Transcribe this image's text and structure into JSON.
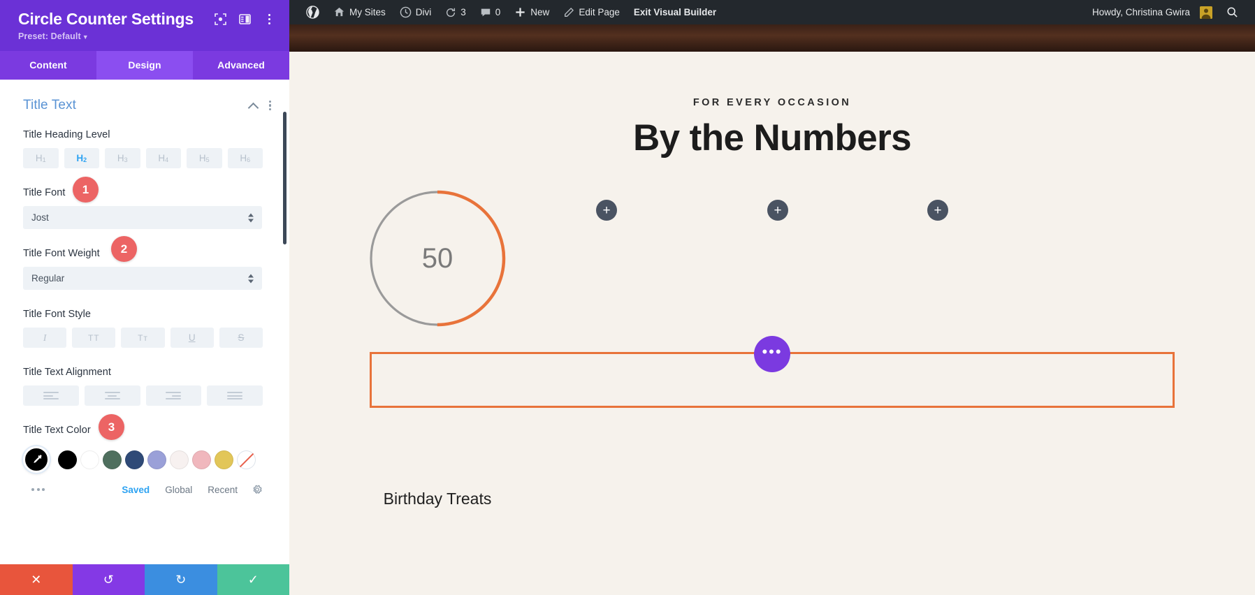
{
  "panel": {
    "title": "Circle Counter Settings",
    "preset_label": "Preset: Default",
    "header_icons": [
      {
        "name": "focus-target-icon"
      },
      {
        "name": "panel-layout-icon"
      },
      {
        "name": "more-options-icon"
      }
    ],
    "tabs": [
      {
        "label": "Content",
        "active": false
      },
      {
        "label": "Design",
        "active": true
      },
      {
        "label": "Advanced",
        "active": false
      }
    ],
    "section": {
      "title": "Title Text",
      "collapse_icon": "chevron-up-icon",
      "menu_icon": "section-options-icon"
    },
    "fields": {
      "heading_level": {
        "label": "Title Heading Level",
        "options": [
          "H1",
          "H2",
          "H3",
          "H4",
          "H5",
          "H6"
        ],
        "option_numbers": [
          "1",
          "2",
          "3",
          "4",
          "5",
          "6"
        ],
        "selected": "H2"
      },
      "title_font": {
        "label": "Title Font",
        "value": "Jost",
        "badge": "1"
      },
      "title_font_weight": {
        "label": "Title Font Weight",
        "value": "Regular",
        "badge": "2"
      },
      "title_font_style": {
        "label": "Title Font Style",
        "options": [
          {
            "glyph": "I",
            "name": "italic"
          },
          {
            "glyph": "TT",
            "name": "uppercase"
          },
          {
            "glyph": "Tᴛ",
            "name": "small-caps"
          },
          {
            "glyph": "U",
            "name": "underline"
          },
          {
            "glyph": "S",
            "name": "strikethrough"
          }
        ]
      },
      "title_text_alignment": {
        "label": "Title Text Alignment",
        "options": [
          "left",
          "center",
          "right",
          "justify"
        ]
      },
      "title_text_color": {
        "label": "Title Text Color",
        "badge": "3",
        "active_tool": "eyedropper",
        "swatches": [
          {
            "hex": "#000000",
            "name": "black"
          },
          {
            "hex": "#ffffff",
            "name": "white"
          },
          {
            "hex": "#4f6f5e",
            "name": "sage-green"
          },
          {
            "hex": "#2f4a77",
            "name": "navy-blue"
          },
          {
            "hex": "#9aa0d8",
            "name": "periwinkle"
          },
          {
            "hex": "#f7f1f0",
            "name": "off-white"
          },
          {
            "hex": "#f0b7bd",
            "name": "blush-pink"
          },
          {
            "hex": "#e2c659",
            "name": "gold"
          },
          {
            "hex": "none",
            "name": "no-color"
          }
        ],
        "tabs": [
          {
            "label": "Saved",
            "active": true
          },
          {
            "label": "Global",
            "active": false
          },
          {
            "label": "Recent",
            "active": false
          }
        ],
        "settings_icon": "gear-icon",
        "more_icon": "more-dots-icon"
      }
    },
    "footer": [
      {
        "name": "cancel-button",
        "glyph": "✕",
        "color": "#e8553c"
      },
      {
        "name": "undo-button",
        "glyph": "↺",
        "color": "#8439e5"
      },
      {
        "name": "redo-button",
        "glyph": "↻",
        "color": "#3b8ee0"
      },
      {
        "name": "save-button",
        "glyph": "✓",
        "color": "#4cc49a"
      }
    ]
  },
  "adminbar": {
    "items": [
      {
        "label": "",
        "icon": "wordpress-logo-icon"
      },
      {
        "label": "My Sites",
        "icon": "multisite-icon"
      },
      {
        "label": "Divi",
        "icon": "divi-icon"
      },
      {
        "label": "3",
        "icon": "updates-icon"
      },
      {
        "label": "0",
        "icon": "comments-icon"
      },
      {
        "label": "New",
        "icon": "plus-icon"
      },
      {
        "label": "Edit Page",
        "icon": "pencil-icon"
      },
      {
        "label": "Exit Visual Builder",
        "icon": ""
      }
    ],
    "greeting": "Howdy, Christina Gwira",
    "avatar_name": "user-avatar",
    "search_icon": "search-icon"
  },
  "page": {
    "eyebrow": "FOR EVERY OCCASION",
    "headline": "By the Numbers",
    "counter": {
      "value": "50",
      "label": "Birthday Treats",
      "percent": 50,
      "arc_color": "#e8733a",
      "track_color": "#9a9a9a"
    },
    "add_buttons": [
      {
        "name": "add-module-button-1",
        "glyph": "+"
      },
      {
        "name": "add-module-button-2",
        "glyph": "+"
      },
      {
        "name": "add-module-button-3",
        "glyph": "+"
      }
    ],
    "row_settings_glyph": "•••",
    "row_border_color": "#e8733a"
  }
}
